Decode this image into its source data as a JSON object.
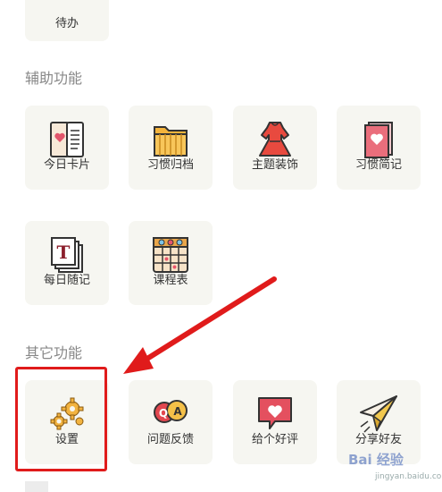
{
  "top_item": {
    "label": "待办"
  },
  "sections": {
    "assist_title": "辅助功能",
    "other_title": "其它功能"
  },
  "assist_items": [
    {
      "label": "今日卡片",
      "icon": "card-icon"
    },
    {
      "label": "习惯归档",
      "icon": "folder-icon"
    },
    {
      "label": "主题装饰",
      "icon": "dress-icon"
    },
    {
      "label": "习惯简记",
      "icon": "heart-card-icon"
    },
    {
      "label": "每日随记",
      "icon": "note-stack-icon"
    },
    {
      "label": "课程表",
      "icon": "timetable-icon"
    }
  ],
  "other_items": [
    {
      "label": "设置",
      "icon": "gears-icon"
    },
    {
      "label": "问题反馈",
      "icon": "qa-icon"
    },
    {
      "label": "给个好评",
      "icon": "heart-bubble-icon"
    },
    {
      "label": "分享好友",
      "icon": "paper-plane-icon"
    }
  ],
  "annotation": {
    "highlight_color": "#e01b1b"
  },
  "watermark": {
    "text": "Bai 经验",
    "sub": "jingyan.baidu.com"
  }
}
